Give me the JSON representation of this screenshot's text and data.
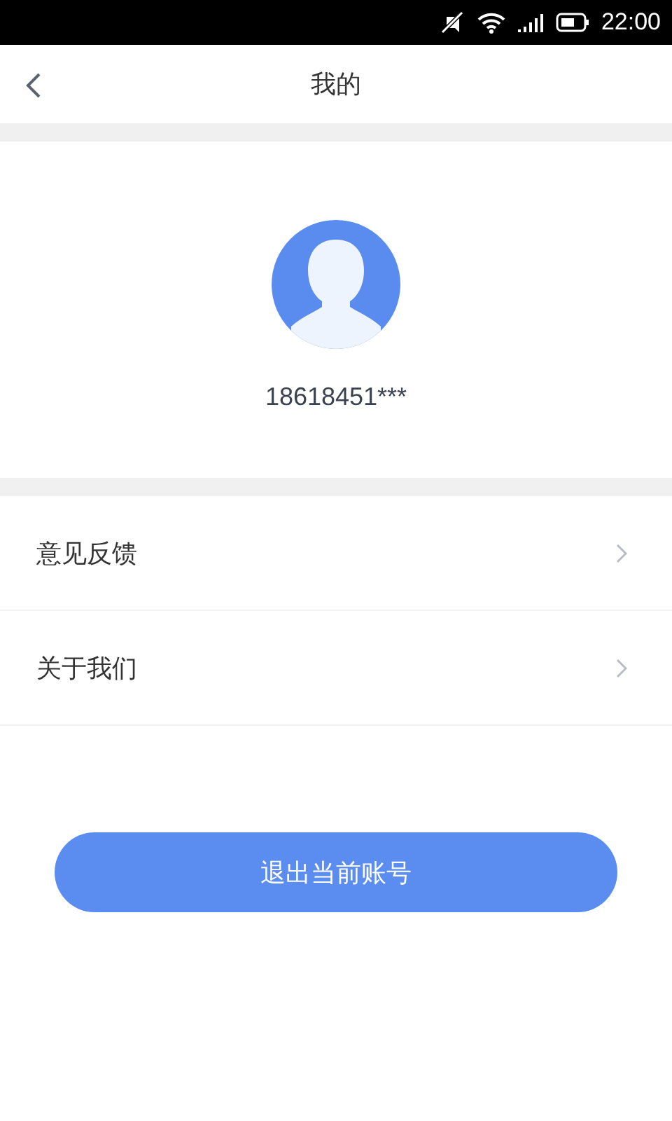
{
  "status_bar": {
    "time": "22:00"
  },
  "header": {
    "title": "我的"
  },
  "profile": {
    "phone": "18618451***"
  },
  "menu": [
    {
      "label": "意见反馈"
    },
    {
      "label": "关于我们"
    }
  ],
  "logout_button": "退出当前账号"
}
